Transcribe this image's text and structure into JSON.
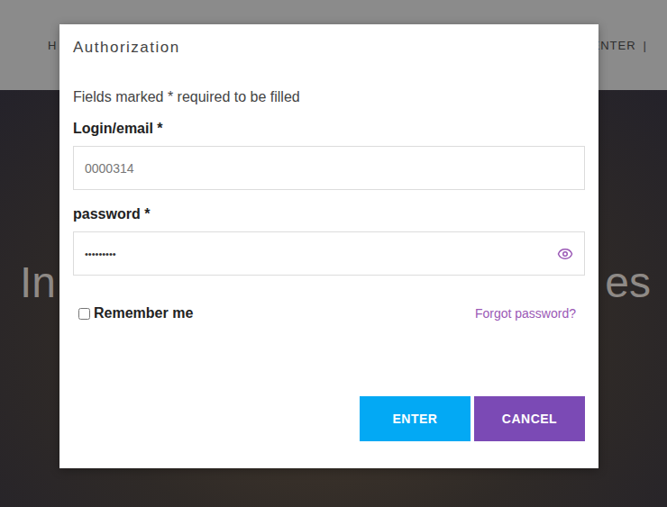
{
  "page": {
    "nav_left": "H",
    "nav_right": "ENTER",
    "nav_separator": "|",
    "hero_left": "In",
    "hero_right": "es"
  },
  "dialog": {
    "title": "Authorization",
    "note": "Fields marked * required to be filled",
    "fields": [
      {
        "label": "Login/email *",
        "value": "0000314",
        "kind": "text"
      },
      {
        "label": "password *",
        "value": "•••••••••",
        "kind": "password"
      }
    ],
    "remember": {
      "label": "Remember me",
      "checked": false
    },
    "forgot": "Forgot password?",
    "buttons": [
      {
        "label": "ENTER",
        "color": "#03a9f4"
      },
      {
        "label": "CANCEL",
        "color": "#7b4ab5"
      }
    ]
  }
}
